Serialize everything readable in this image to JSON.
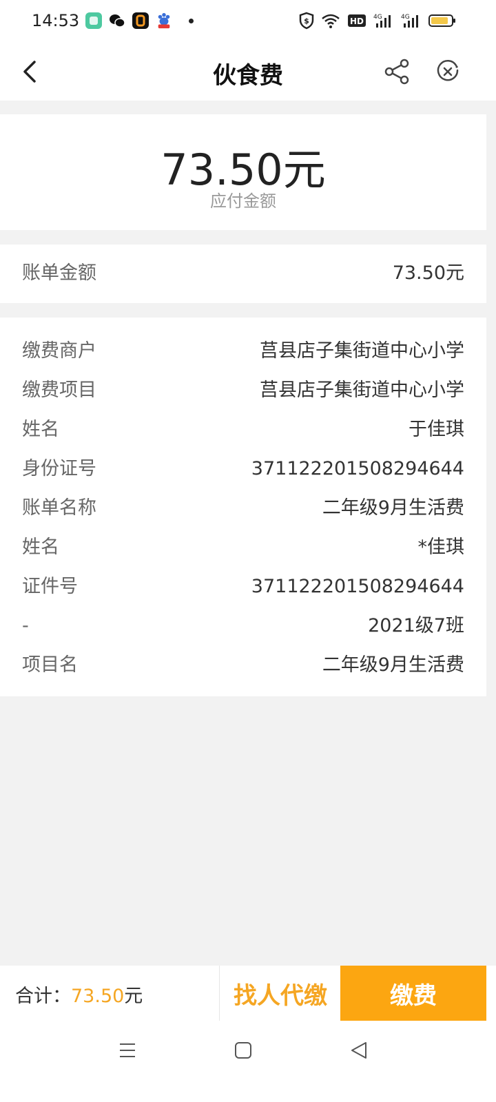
{
  "status_bar": {
    "time": "14:53",
    "network_label": "4G",
    "network_label_2": "4G",
    "hd_label": "HD"
  },
  "nav": {
    "title": "伙食费"
  },
  "amount": {
    "value": "73.50元",
    "label": "应付金额"
  },
  "bill": {
    "label": "账单金额",
    "value": "73.50元"
  },
  "details": [
    {
      "label": "缴费商户",
      "value": "莒县店子集街道中心小学"
    },
    {
      "label": "缴费项目",
      "value": "莒县店子集街道中心小学"
    },
    {
      "label": "姓名",
      "value": "于佳琪"
    },
    {
      "label": "身份证号",
      "value": "371122201508294644"
    },
    {
      "label": "账单名称",
      "value": "二年级9月生活费"
    },
    {
      "label": "姓名",
      "value": "*佳琪"
    },
    {
      "label": "证件号",
      "value": "371122201508294644"
    },
    {
      "label": "-",
      "value": "2021级7班"
    },
    {
      "label": "项目名",
      "value": "二年级9月生活费"
    }
  ],
  "bottom": {
    "total_label": "合计：",
    "total_amount": "73.50",
    "total_unit": "元",
    "proxy_label": "找人代缴",
    "pay_label": "缴费"
  },
  "colors": {
    "accent": "#fca611",
    "accent_text": "#f5a623"
  }
}
